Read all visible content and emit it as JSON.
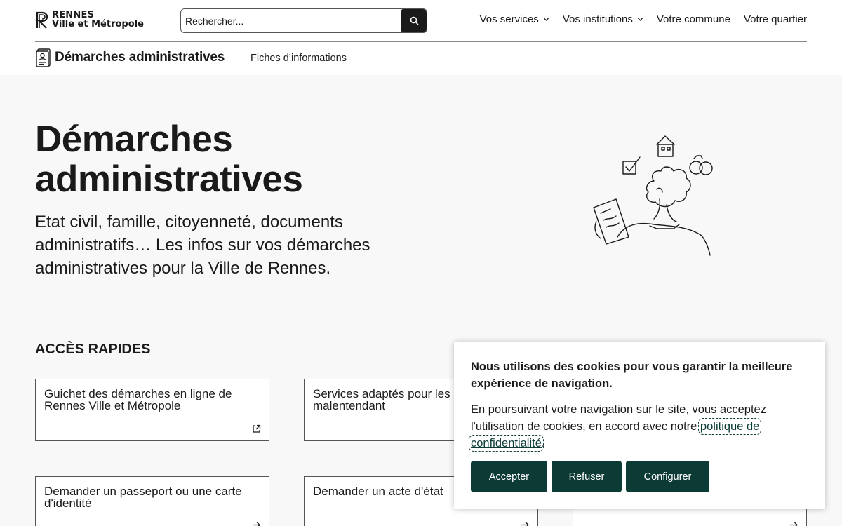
{
  "brand": {
    "line1": "RENNES",
    "line2": "Ville et Métropole"
  },
  "search": {
    "placeholder": "Rechercher..."
  },
  "nav": {
    "items": [
      {
        "label": "Vos services",
        "has_dropdown": true
      },
      {
        "label": "Vos institutions",
        "has_dropdown": true
      },
      {
        "label": "Votre commune",
        "has_dropdown": false
      },
      {
        "label": "Votre quartier",
        "has_dropdown": false
      }
    ]
  },
  "subnav": {
    "title": "Démarches administratives",
    "link": "Fiches d’informations"
  },
  "hero": {
    "title": "Démarches administratives",
    "subtitle": "Etat civil, famille, citoyenneté, documents administratifs… Les infos sur vos démarches administratives pour la Ville de Rennes."
  },
  "quick_access": {
    "title": "ACCÈS RAPIDES",
    "cards": [
      {
        "label": "Guichet des démarches en ligne de Rennes Ville et Métropole",
        "icon": "external-link-icon"
      },
      {
        "label": "Services adaptés pour les sourdes ou malentendant",
        "icon": ""
      },
      {
        "label": "Demander un passeport ou une carte d'identité",
        "icon": "arrow-right-icon"
      },
      {
        "label": "Demander un acte d'état",
        "icon": "arrow-right-icon"
      },
      {
        "label": "",
        "icon": "arrow-right-icon"
      }
    ]
  },
  "cookie": {
    "heading": "Nous utilisons des cookies pour vous garantir la meilleure expérience de navigation.",
    "body_prefix": "En poursuivant votre navigation sur le site, vous acceptez l'utilisation de cookies, en accord avec notre ",
    "link": "politique de confidentialité",
    "body_suffix": ".",
    "buttons": {
      "accept": "Accepter",
      "refuse": "Refuser",
      "configure": "Configurer"
    }
  },
  "colors": {
    "dark": "#1a1a1a",
    "cookie_button": "#0c3a35",
    "background": "#f8f8f8"
  }
}
